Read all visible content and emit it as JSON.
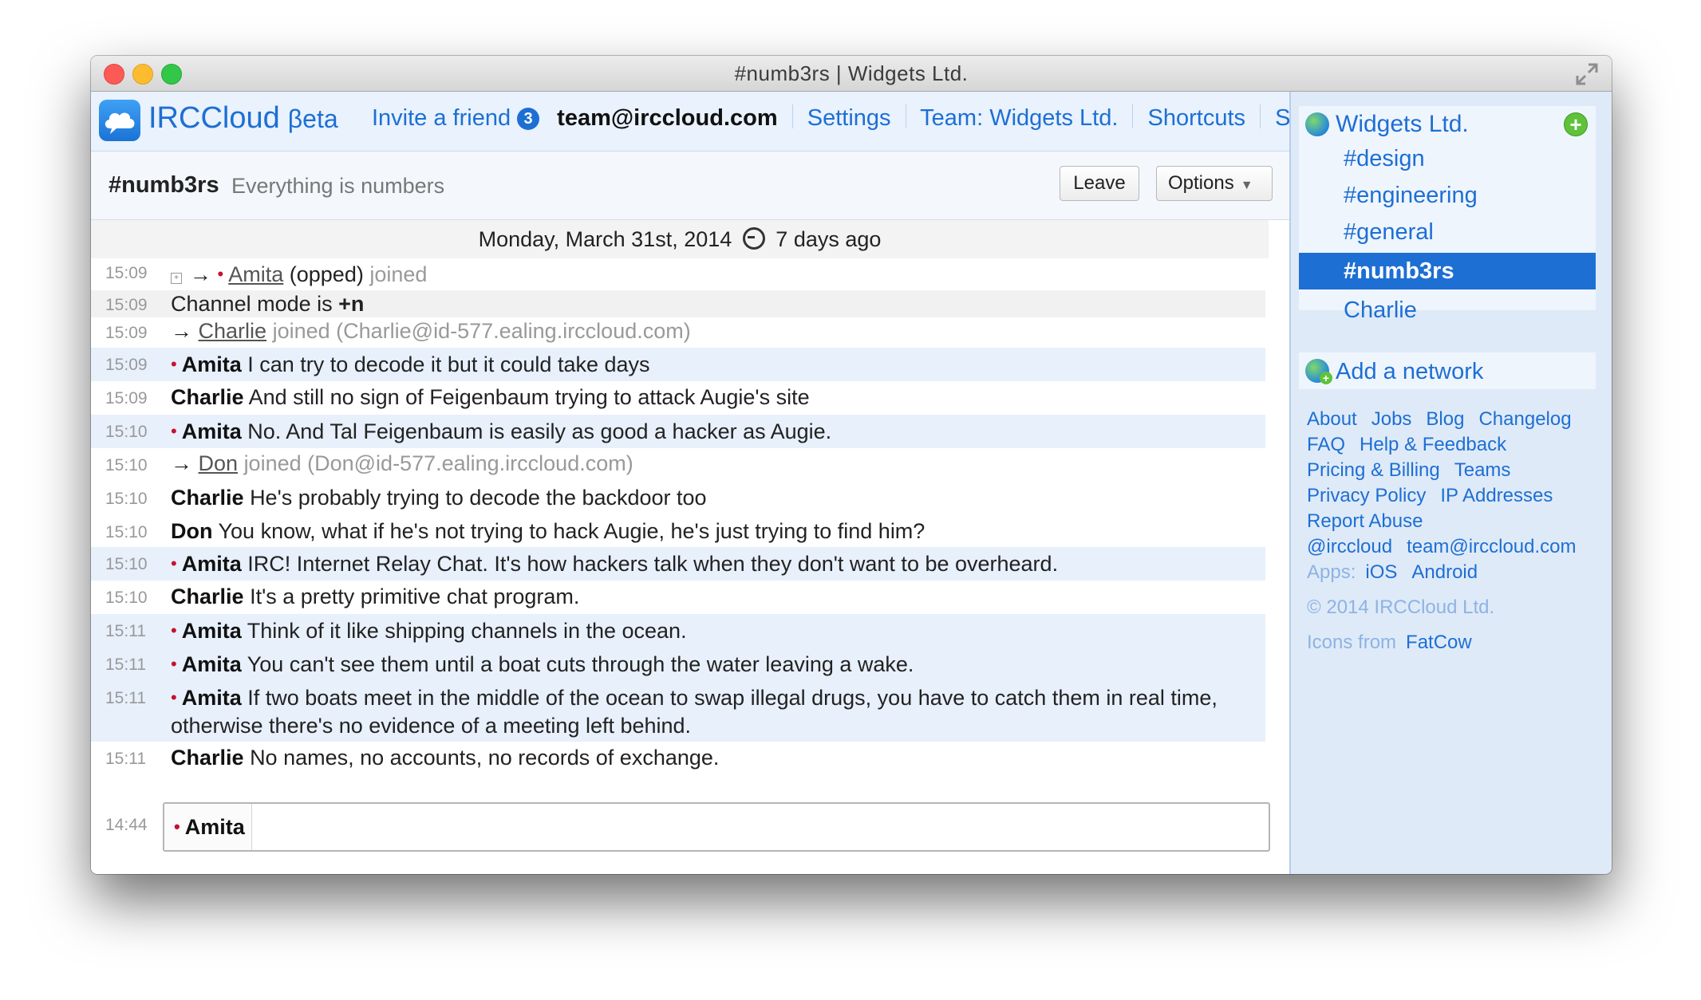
{
  "window": {
    "title": "#numb3rs | Widgets Ltd."
  },
  "header": {
    "logo": "IRCCloud",
    "beta": "βeta",
    "invite_label": "Invite a friend",
    "invite_count": "3",
    "account": "team@irccloud.com",
    "settings": "Settings",
    "team": "Team: Widgets Ltd.",
    "shortcuts": "Shortcuts",
    "signout": "Sign out"
  },
  "channel": {
    "name": "#numb3rs",
    "topic": "Everything is numbers",
    "leave": "Leave",
    "options": "Options",
    "options_caret": "▼"
  },
  "buffer": {
    "date": "Monday, March 31st, 2014",
    "ago": "7 days ago",
    "messages": [
      {
        "ts": "15:09",
        "arrow": "→",
        "dot": "•",
        "nick": "Amita",
        "mode": "(opped)",
        "text": "joined"
      },
      {
        "ts": "15:09",
        "text": "Channel mode is ",
        "bold": "+n"
      },
      {
        "ts": "15:09",
        "arrow": "→",
        "nick": "Charlie",
        "text": "joined (Charlie@id-577.ealing.irccloud.com)"
      },
      {
        "ts": "15:09",
        "dot": "•",
        "nick": "Amita",
        "text": "I can try to decode it but it could take days"
      },
      {
        "ts": "15:09",
        "nick": "Charlie",
        "text": "And still no sign of Feigenbaum trying to attack Augie's site"
      },
      {
        "ts": "15:10",
        "dot": "•",
        "nick": "Amita",
        "text": "No. And Tal Feigenbaum is easily as good a hacker as Augie."
      },
      {
        "ts": "15:10",
        "arrow": "→",
        "nick": "Don",
        "text": "joined (Don@id-577.ealing.irccloud.com)"
      },
      {
        "ts": "15:10",
        "nick": "Charlie",
        "text": "He's probably trying to decode the backdoor too"
      },
      {
        "ts": "15:10",
        "nick": "Don",
        "text": "You know, what if he's not trying to hack Augie, he's just trying to find him?"
      },
      {
        "ts": "15:10",
        "dot": "•",
        "nick": "Amita",
        "text": "IRC! Internet Relay Chat. It's how hackers talk when they don't want to be overheard."
      },
      {
        "ts": "15:10",
        "nick": "Charlie",
        "text": "It's a pretty primitive chat program."
      },
      {
        "ts": "15:11",
        "dot": "•",
        "nick": "Amita",
        "text": " Think of it like shipping channels in the ocean."
      },
      {
        "ts": "15:11",
        "dot": "•",
        "nick": "Amita",
        "text": "You can't see them until a boat cuts through the water leaving a wake."
      },
      {
        "ts": "15:11",
        "dot": "•",
        "nick": "Amita",
        "text": "If two boats meet in the middle of the ocean to swap illegal drugs, you have to catch them in real time, otherwise there's no evidence of a meeting left behind."
      },
      {
        "ts": "15:11",
        "nick": "Charlie",
        "text": "No names, no accounts, no records of exchange."
      }
    ]
  },
  "input": {
    "ts": "14:44",
    "dot": "•",
    "nick": "Amita",
    "value": ""
  },
  "sidebar": {
    "network": "Widgets Ltd.",
    "add_symbol": "+",
    "channels": [
      "#design",
      "#engineering",
      "#general",
      "#numb3rs"
    ],
    "query": "Charlie",
    "add_network": "Add a network",
    "links": {
      "about": "About",
      "jobs": "Jobs",
      "blog": "Blog",
      "changelog": "Changelog",
      "faq": "FAQ",
      "help": "Help & Feedback",
      "pricing": "Pricing & Billing",
      "teams": "Teams",
      "privacy": "Privacy Policy",
      "ip": "IP Addresses",
      "abuse": "Report Abuse",
      "twitter": "@irccloud",
      "email": "team@irccloud.com",
      "apps_label": "Apps:",
      "ios": "iOS",
      "android": "Android",
      "copyright": "© 2014 IRCCloud Ltd.",
      "icons_from": "Icons from",
      "fatcow": "FatCow"
    }
  }
}
